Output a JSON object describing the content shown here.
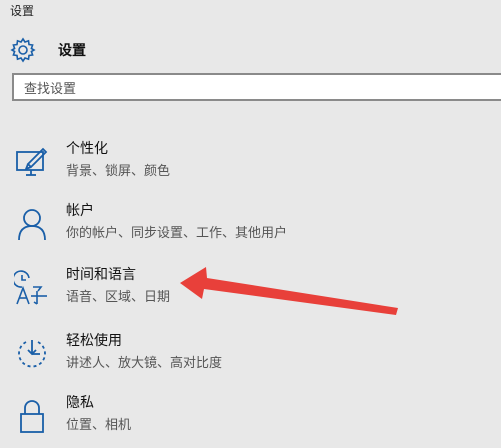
{
  "window": {
    "title": "设置"
  },
  "header": {
    "icon": "gear-icon",
    "title": "设置"
  },
  "search": {
    "placeholder": "查找设置"
  },
  "items": [
    {
      "icon": "personalization-icon",
      "name": "个性化",
      "desc": "背景、锁屏、颜色"
    },
    {
      "icon": "account-icon",
      "name": "帐户",
      "desc": "你的帐户、同步设置、工作、其他用户"
    },
    {
      "icon": "time-language-icon",
      "name": "时间和语言",
      "desc": "语音、区域、日期"
    },
    {
      "icon": "ease-of-access-icon",
      "name": "轻松使用",
      "desc": "讲述人、放大镜、高对比度"
    },
    {
      "icon": "lock-icon",
      "name": "隐私",
      "desc": "位置、相机"
    }
  ],
  "colors": {
    "accent": "#1a5fa8",
    "annotation": "#e8403a",
    "background": "#e8e8e8"
  }
}
